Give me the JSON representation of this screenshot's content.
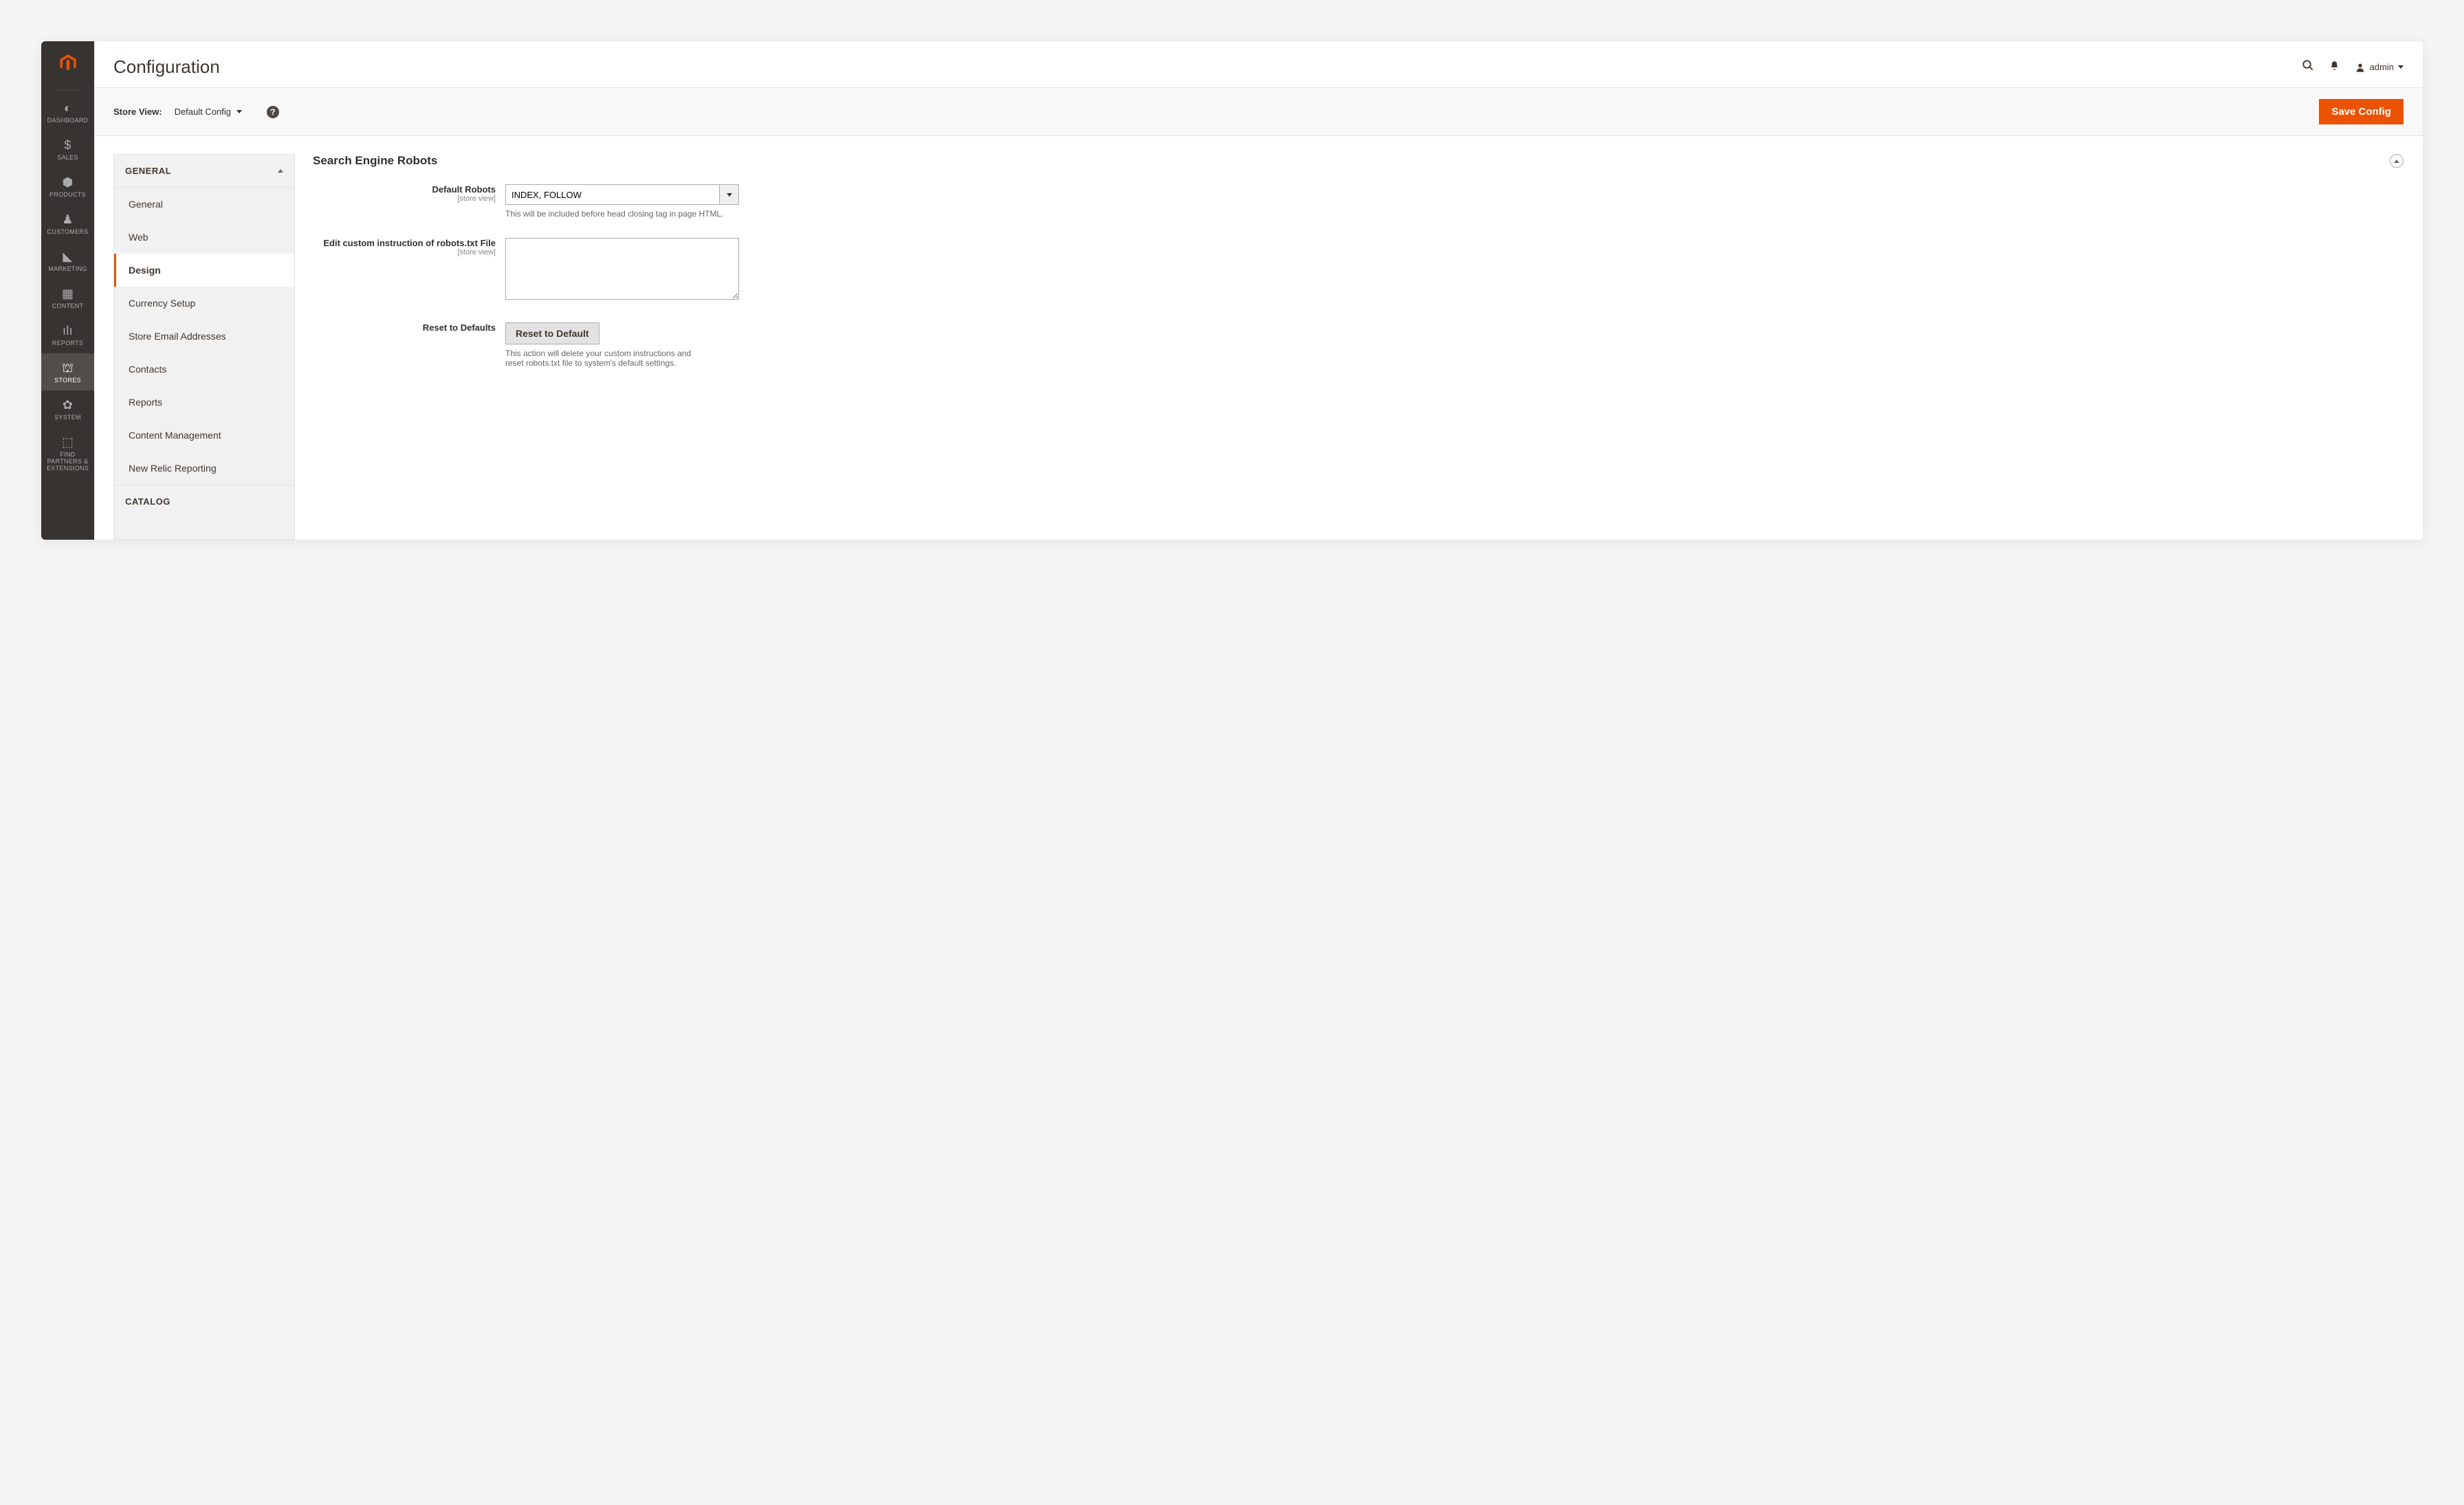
{
  "header": {
    "title": "Configuration",
    "username": "admin"
  },
  "scope": {
    "label": "Store View:",
    "selected": "Default Config",
    "save_label": "Save Config"
  },
  "nav": {
    "items": [
      {
        "label": "DASHBOARD"
      },
      {
        "label": "SALES"
      },
      {
        "label": "PRODUCTS"
      },
      {
        "label": "CUSTOMERS"
      },
      {
        "label": "MARKETING"
      },
      {
        "label": "CONTENT"
      },
      {
        "label": "REPORTS"
      },
      {
        "label": "STORES"
      },
      {
        "label": "SYSTEM"
      },
      {
        "label": "FIND PARTNERS & EXTENSIONS"
      }
    ]
  },
  "config_nav": {
    "group_label": "GENERAL",
    "items": [
      {
        "label": "General"
      },
      {
        "label": "Web"
      },
      {
        "label": "Design"
      },
      {
        "label": "Currency Setup"
      },
      {
        "label": "Store Email Addresses"
      },
      {
        "label": "Contacts"
      },
      {
        "label": "Reports"
      },
      {
        "label": "Content Management"
      },
      {
        "label": "New Relic Reporting"
      }
    ],
    "group2_label": "CATALOG"
  },
  "section": {
    "title": "Search Engine Robots",
    "fields": {
      "default_robots": {
        "label": "Default Robots",
        "scope": "[store view]",
        "value": "INDEX, FOLLOW",
        "helper": "This will be included before head closing tag in page HTML."
      },
      "custom_robots": {
        "label": "Edit custom instruction of robots.txt File",
        "scope": "[store view]",
        "value": ""
      },
      "reset": {
        "label": "Reset to Defaults",
        "button": "Reset to Default",
        "helper": "This action will delete your custom instructions and reset robots.txt file to system's default settings."
      }
    }
  }
}
